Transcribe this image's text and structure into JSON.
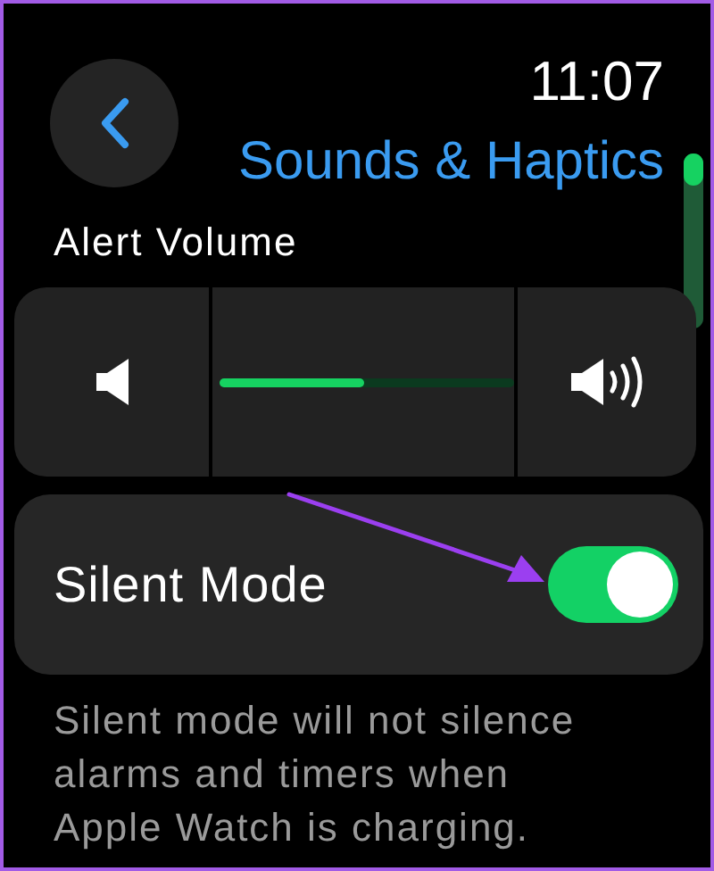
{
  "time": "11:07",
  "title": "Sounds & Haptics",
  "alert_volume": {
    "label": "Alert Volume",
    "level": 0.49
  },
  "silent_mode": {
    "label": "Silent Mode",
    "on": true
  },
  "footnote": "Silent mode will not silence alarms and timers when Apple Watch is charging.",
  "annotation": {
    "kind": "arrow",
    "color": "#9b3ff0"
  }
}
